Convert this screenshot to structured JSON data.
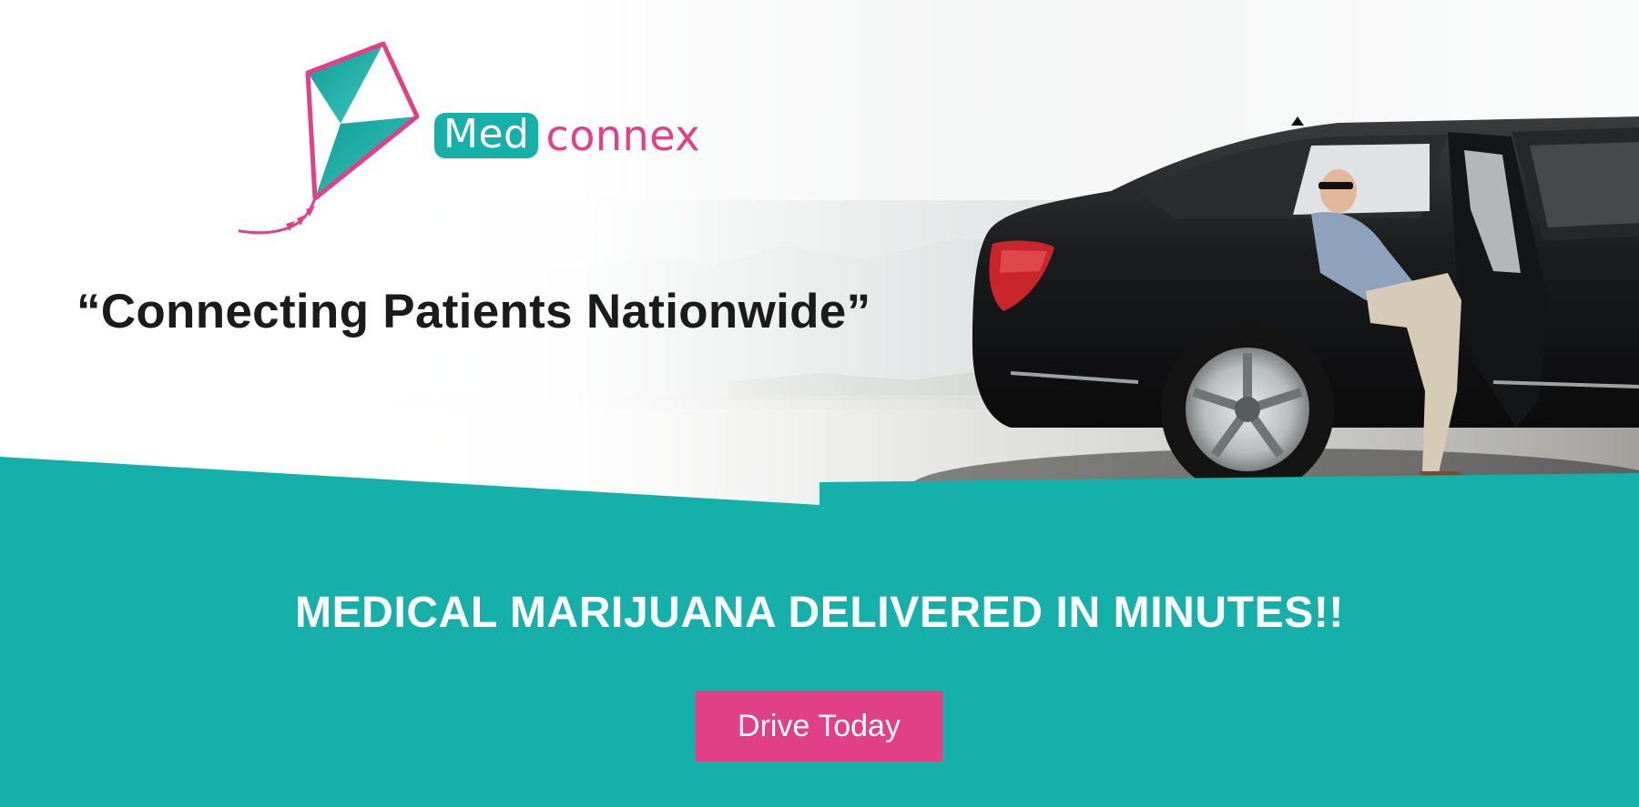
{
  "brand": {
    "name_part1": "Med",
    "name_part2": "connex",
    "logo_icon": "kite-icon",
    "colors": {
      "teal": "#14b0a9",
      "pink": "#e13f86",
      "text": "#1b1b1b"
    }
  },
  "hero": {
    "tagline": "“Connecting Patients Nationwide”",
    "image": "car-chauffeur-photo",
    "band_title": "MEDICAL MARIJUANA DELIVERED IN MINUTES!!",
    "cta_label": "Drive Today"
  }
}
